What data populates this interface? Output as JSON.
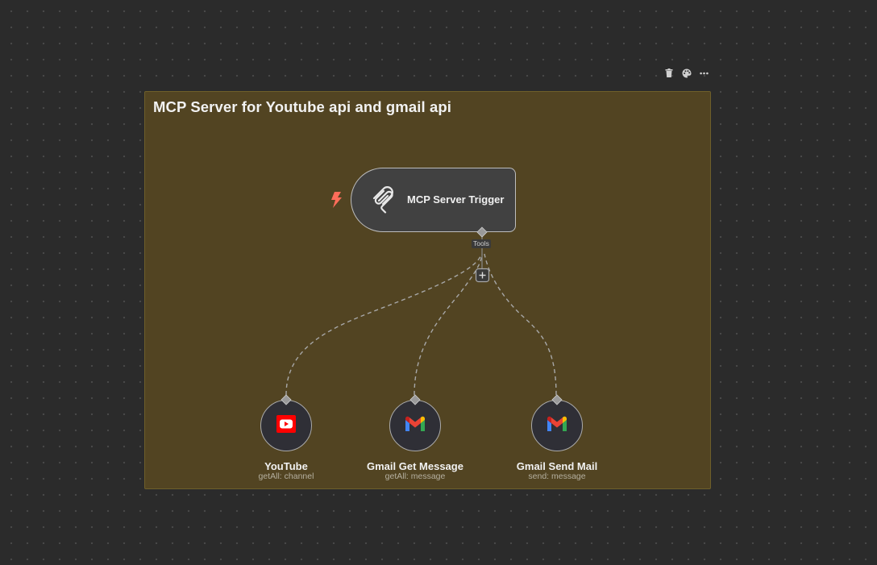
{
  "sticky": {
    "title": "MCP Server for Youtube api and gmail api",
    "toolbar": [
      "trash-icon",
      "palette-icon",
      "more-icon"
    ]
  },
  "trigger": {
    "label": "MCP Server Trigger",
    "icon": "mcp-icon",
    "connector_label": "Tools",
    "trigger_badge_icon": "bolt-icon",
    "add_tool_icon": "plus-icon"
  },
  "tools": [
    {
      "title": "YouTube",
      "subtitle": "getAll: channel",
      "icon": "youtube-icon"
    },
    {
      "title": "Gmail Get Message",
      "subtitle": "getAll: message",
      "icon": "gmail-icon"
    },
    {
      "title": "Gmail Send Mail",
      "subtitle": "send: message",
      "icon": "gmail-icon"
    }
  ],
  "colors": {
    "canvas": "#2b2b2b",
    "sticky": "#524422",
    "trigger_bolt": "#ff6d5a",
    "youtube_red": "#ff0000"
  }
}
